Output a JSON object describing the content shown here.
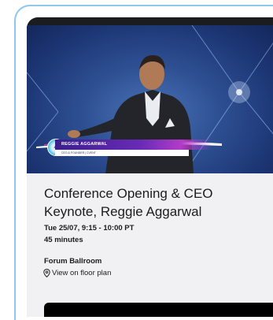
{
  "video": {
    "speaker_name": "REGGIE AGGARWAL",
    "speaker_title": "CEO & FOUNDER | CVENT",
    "logo_glyph": "▲"
  },
  "session": {
    "title": "Conference Opening & CEO Keynote, Reggie Aggarwal",
    "time": "Tue 25/07, 9:15 - 10:00 PT",
    "duration": "45 minutes",
    "room": "Forum Ballroom",
    "floor_plan_link": "View on floor plan"
  },
  "icons": {
    "floor_plan": "map-pin-icon"
  },
  "colors": {
    "card_border": "#8cc7ec",
    "details_bg": "#f1f1f3",
    "video_bg": "#2d4f92",
    "lower_third_accent": "#6a2bb6"
  }
}
